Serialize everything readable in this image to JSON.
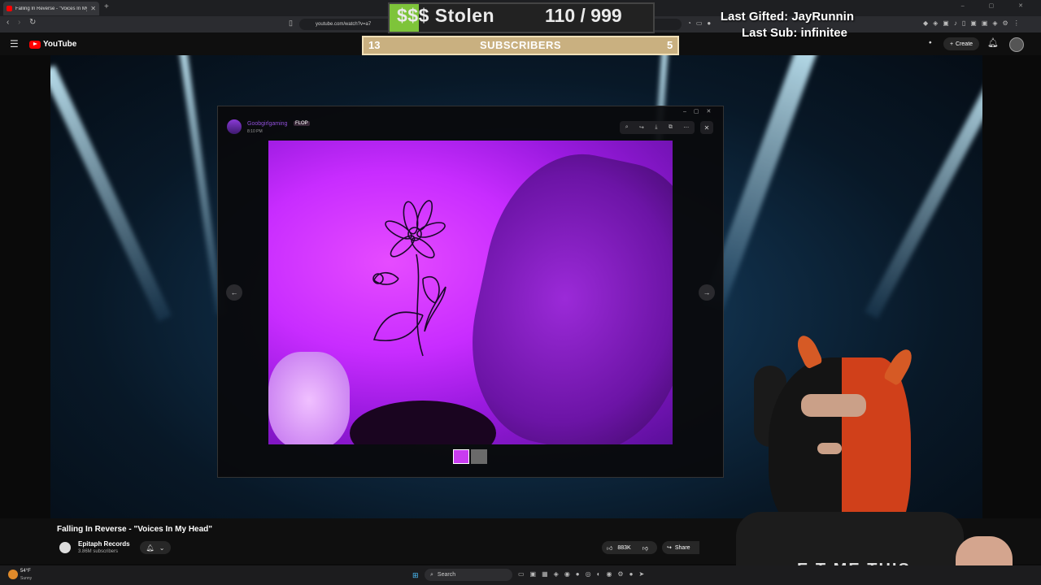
{
  "browser": {
    "tab_title": "Falling In Reverse - \"Voices In My Head\"",
    "url": "youtube.com/watch?v=a7",
    "new_tab_symbol": "+",
    "window_controls": "– ▢ ✕"
  },
  "youtube": {
    "logo_text": "YouTube",
    "create_label": "Create"
  },
  "overlay": {
    "stolen_label": "$$$ Stolen",
    "stolen_count": "110 / 999",
    "stolen_progress": 0.11,
    "sub_left": "13",
    "sub_center": "SUBSCRIBERS",
    "sub_right": "5",
    "last_gifted": "Last Gifted: JayRunnin",
    "last_sub": "Last Sub: infinitee"
  },
  "viewer": {
    "username": "Goobgirlgaming",
    "badge": "FLOP",
    "time": "8:10 PM"
  },
  "video": {
    "title": "Falling In Reverse - \"Voices In My Head\"",
    "channel": "Epitaph Records",
    "subscribers": "3.86M subscribers",
    "likes": "883K",
    "share_label": "Share"
  },
  "webcam": {
    "shirt_text": "E T ME   THIS"
  },
  "taskbar": {
    "temp": "54°F",
    "condition": "Sunny",
    "search_placeholder": "Search"
  },
  "colors": {
    "accent_green": "#7ec43a",
    "youtube_red": "#ff0000",
    "subs_bar": "#c9b080"
  }
}
